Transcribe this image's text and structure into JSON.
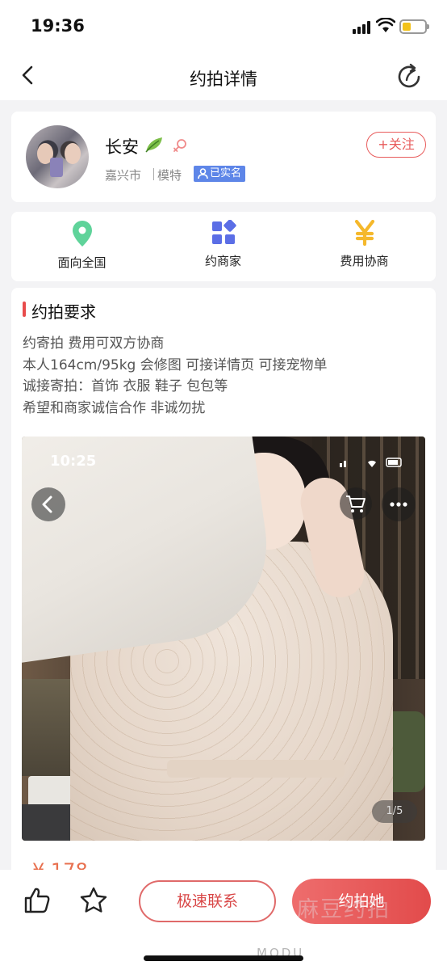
{
  "status_bar": {
    "time": "19:36"
  },
  "nav": {
    "title": "约拍详情"
  },
  "profile": {
    "name": "长安",
    "location": "嘉兴市",
    "role": "模特",
    "verified": "已实名",
    "follow_label": "+关注"
  },
  "features": [
    {
      "label": "面向全国",
      "icon": "location-pin-icon",
      "color": "#5fd39a"
    },
    {
      "label": "约商家",
      "icon": "grid-apps-icon",
      "color": "#5b6ee6"
    },
    {
      "label": "费用协商",
      "icon": "yen-icon",
      "color": "#f5b82b"
    }
  ],
  "requirements": {
    "title": "约拍要求",
    "lines": [
      "约寄拍 费用可双方协商",
      "本人164cm/95kg 会修图 可接详情页 可接宠物单",
      "诚接寄拍：首饰 衣服 鞋子 包包等",
      "希望和商家诚信合作 非诚勿扰"
    ]
  },
  "photo": {
    "embedded_time": "10:25",
    "counter": "1/5"
  },
  "price_peek": "¥ 178",
  "bottom_bar": {
    "contact_label": "极速联系",
    "book_label": "约拍她",
    "watermark": "麻豆约拍",
    "watermark_bottom": "MODU"
  },
  "colors": {
    "accent_red": "#e24b4b",
    "verified_blue": "#5e86e8"
  }
}
